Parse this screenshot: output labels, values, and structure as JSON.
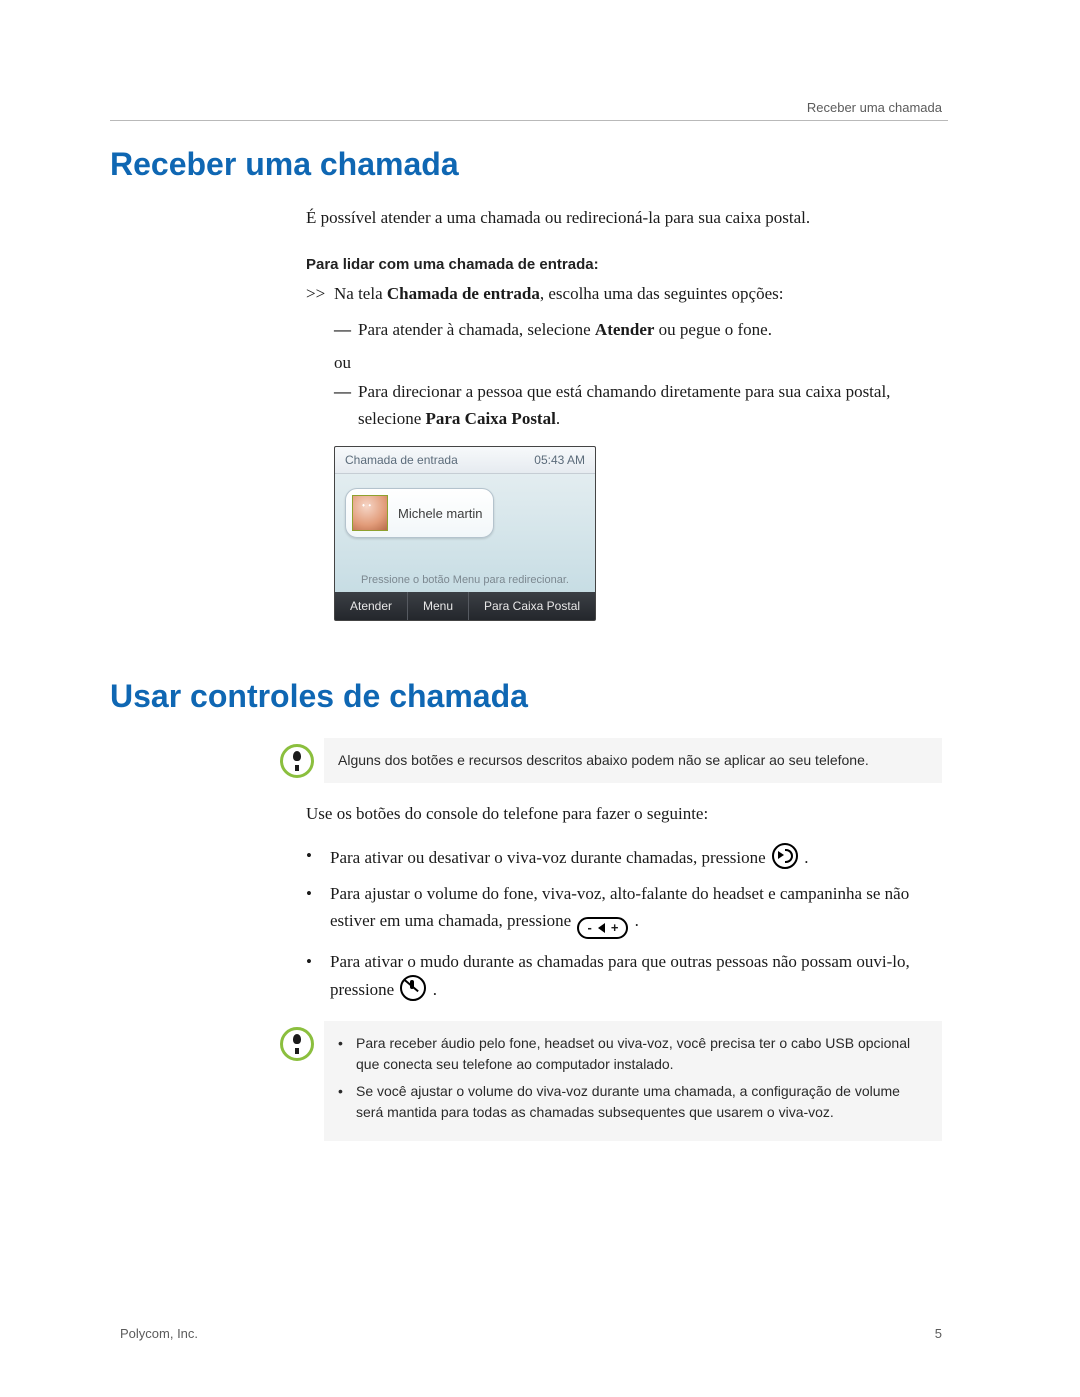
{
  "header": {
    "right": "Receber uma chamada"
  },
  "section1": {
    "title": "Receber uma chamada",
    "intro": "É possível atender a uma chamada ou redirecioná-la para sua caixa postal.",
    "sub": "Para lidar com uma chamada de entrada:",
    "lead_arrow": ">>",
    "lead_pre": "Na tela ",
    "lead_bold": "Chamada de entrada",
    "lead_post": ", escolha uma das seguintes opções:",
    "opt1_pre": "Para atender à chamada, selecione ",
    "opt1_bold": "Atender",
    "opt1_post": " ou pegue o fone.",
    "or": "ou",
    "opt2_pre": "Para direcionar a pessoa que está chamando diretamente para sua caixa postal, selecione ",
    "opt2_bold": "Para Caixa Postal",
    "opt2_post": "."
  },
  "phone": {
    "title": "Chamada de entrada",
    "time": "05:43 AM",
    "contact": "Michele martin",
    "hint": "Pressione o botão Menu para redirecionar.",
    "btn_left": "Atender",
    "btn_mid": "Menu",
    "btn_right": "Para Caixa Postal"
  },
  "section2": {
    "title": "Usar controles de chamada",
    "note1": "Alguns dos botões e recursos descritos abaixo podem não se aplicar ao seu telefone.",
    "lead": "Use os botões do console do telefone para fazer o seguinte:",
    "b1_pre": "Para ativar ou desativar o viva-voz durante chamadas, pressione ",
    "b1_post": " .",
    "b2": "Para ajustar o volume do fone, viva-voz, alto-falante do headset e campaninha se não estiver em uma chamada, pressione ",
    "b2_post": " .",
    "b3_pre": "Para ativar o mudo durante as chamadas para que outras pessoas não possam ouvi-lo, pressione ",
    "b3_post": " .",
    "note2a": "Para receber áudio pelo fone, headset ou viva-voz, você precisa ter o cabo USB opcional que conecta seu telefone ao computador instalado.",
    "note2b": "Se você ajustar o volume do viva-voz durante uma chamada, a configuração de volume será mantida para todas as chamadas subsequentes que usarem o viva-voz."
  },
  "vol": {
    "minus": "-",
    "plus": "+"
  },
  "footer": {
    "left": "Polycom, Inc.",
    "page": "5"
  }
}
